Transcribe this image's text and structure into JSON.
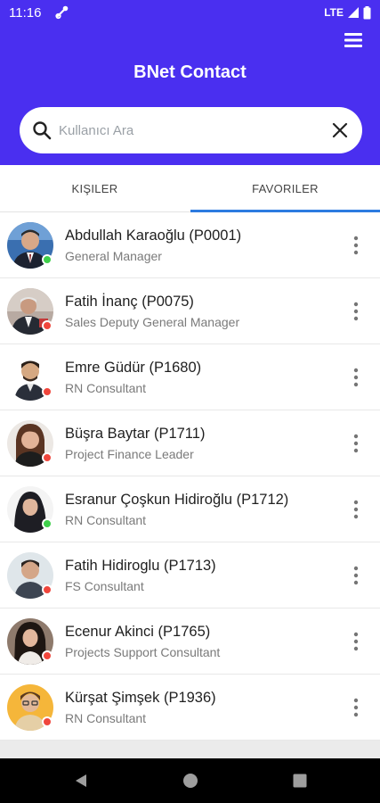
{
  "status_bar": {
    "time": "11:16",
    "network": "LTE"
  },
  "header": {
    "title": "BNet Contact"
  },
  "search": {
    "placeholder": "Kullanıcı Ara",
    "value": ""
  },
  "tabs": [
    {
      "label": "KIŞILER",
      "active": false
    },
    {
      "label": "FAVORILER",
      "active": true
    }
  ],
  "colors": {
    "header_bg": "#4a2ff0",
    "tab_indicator": "#2d7be0",
    "online": "#3ecf4a",
    "offline": "#f0463c"
  },
  "contacts": [
    {
      "name": "Abdullah Karaoğlu (P0001)",
      "title": "General Manager",
      "status": "online"
    },
    {
      "name": "Fatih İnanç (P0075)",
      "title": "Sales Deputy General Manager",
      "status": "offline"
    },
    {
      "name": "Emre Güdür (P1680)",
      "title": "RN Consultant",
      "status": "offline"
    },
    {
      "name": "Büşra Baytar (P1711)",
      "title": "Project Finance Leader",
      "status": "offline"
    },
    {
      "name": "Esranur Çoşkun Hidiroğlu (P1712)",
      "title": "RN Consultant",
      "status": "online"
    },
    {
      "name": "Fatih Hidiroglu (P1713)",
      "title": "FS Consultant",
      "status": "offline"
    },
    {
      "name": "Ecenur Akinci (P1765)",
      "title": "Projects Support Consultant",
      "status": "offline"
    },
    {
      "name": "Kürşat Şimşek (P1936)",
      "title": "RN Consultant",
      "status": "offline"
    }
  ]
}
